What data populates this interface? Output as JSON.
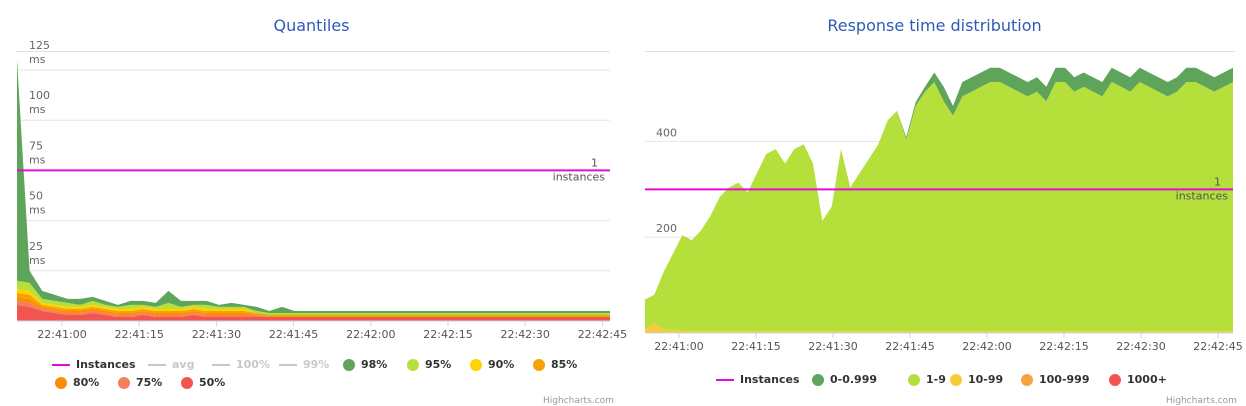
{
  "panels": {
    "left": {
      "title": "Quantiles",
      "credit": "Highcharts.com"
    },
    "right": {
      "title": "Response time distribution",
      "credit": "Highcharts.com"
    }
  },
  "chart_data": [
    {
      "type": "area",
      "title": "Quantiles",
      "x_ticks": [
        "22:41:00",
        "22:41:15",
        "22:41:30",
        "22:41:45",
        "22:42:00",
        "22:42:15",
        "22:42:30",
        "22:42:45"
      ],
      "y_ticks": [
        {
          "value": 25,
          "label": "25",
          "unit": "ms"
        },
        {
          "value": 50,
          "label": "50",
          "unit": "ms"
        },
        {
          "value": 75,
          "label": "75",
          "unit": "ms"
        },
        {
          "value": 100,
          "label": "100",
          "unit": "ms"
        },
        {
          "value": 125,
          "label": "125",
          "unit": "ms"
        }
      ],
      "ylim": [
        0,
        130
      ],
      "instances_line": {
        "value": 75,
        "label_top": "1",
        "label_bottom": "instances",
        "color": "#e30cd8"
      },
      "stacked_series": [
        {
          "name": "50%",
          "color": "#f2554f",
          "values": [
            8,
            7,
            5,
            4,
            3,
            3,
            4,
            3,
            2,
            2,
            3,
            2,
            2,
            2,
            3,
            2,
            2,
            2,
            2,
            2,
            2,
            2,
            2,
            2,
            2,
            2,
            2,
            2,
            2,
            2,
            2,
            2,
            2,
            2,
            2,
            2,
            2,
            2,
            2,
            2,
            2,
            2,
            2,
            2,
            2,
            2,
            2,
            2
          ]
        },
        {
          "name": "75%",
          "color": "#f3805a",
          "values": [
            2,
            2,
            1,
            1,
            1,
            1,
            1,
            1,
            1,
            1,
            1,
            1,
            1,
            1,
            1,
            1,
            1,
            1,
            1,
            1,
            0,
            0,
            0,
            0,
            0,
            0,
            0,
            0,
            0,
            0,
            0,
            0,
            0,
            0,
            0,
            0,
            0,
            0,
            0,
            0,
            0,
            0,
            0,
            0,
            0,
            0,
            0,
            0
          ]
        },
        {
          "name": "80%",
          "color": "#ff8c00",
          "values": [
            2,
            2,
            1,
            1,
            1,
            1,
            1,
            1,
            1,
            1,
            1,
            1,
            1,
            1,
            1,
            1,
            1,
            1,
            1,
            0,
            0,
            0,
            0,
            0,
            0,
            0,
            0,
            0,
            0,
            0,
            0,
            0,
            0,
            0,
            0,
            0,
            0,
            0,
            0,
            0,
            0,
            0,
            0,
            0,
            0,
            0,
            0,
            0
          ]
        },
        {
          "name": "85%",
          "color": "#f5a300",
          "values": [
            2,
            2,
            1,
            1,
            1,
            1,
            1,
            1,
            1,
            1,
            1,
            1,
            1,
            1,
            1,
            1,
            1,
            1,
            1,
            1,
            1,
            1,
            1,
            1,
            1,
            1,
            1,
            1,
            1,
            1,
            1,
            1,
            1,
            1,
            1,
            1,
            1,
            1,
            1,
            1,
            1,
            1,
            1,
            1,
            1,
            1,
            1,
            1
          ]
        },
        {
          "name": "90%",
          "color": "#ffd200",
          "values": [
            2,
            2,
            1,
            1,
            1,
            1,
            1,
            1,
            1,
            1,
            1,
            1,
            1,
            1,
            1,
            1,
            1,
            1,
            1,
            0,
            0,
            0,
            0,
            0,
            0,
            0,
            0,
            0,
            0,
            0,
            0,
            0,
            0,
            0,
            0,
            0,
            0,
            0,
            0,
            0,
            0,
            0,
            0,
            0,
            0,
            0,
            0,
            0
          ]
        },
        {
          "name": "95%",
          "color": "#b5e03b",
          "values": [
            4,
            4,
            2,
            2,
            2,
            1,
            2,
            1,
            1,
            2,
            1,
            1,
            3,
            1,
            1,
            2,
            1,
            1,
            1,
            1,
            1,
            1,
            1,
            1,
            1,
            1,
            1,
            1,
            1,
            1,
            1,
            1,
            1,
            1,
            1,
            1,
            1,
            1,
            1,
            1,
            1,
            1,
            1,
            1,
            1,
            1,
            1,
            1
          ]
        },
        {
          "name": "98%",
          "color": "#5ea45a",
          "values": [
            110,
            6,
            4,
            3,
            2,
            3,
            2,
            2,
            1,
            2,
            2,
            2,
            6,
            3,
            2,
            2,
            1,
            2,
            1,
            2,
            1,
            3,
            1,
            1,
            1,
            1,
            1,
            1,
            1,
            1,
            1,
            1,
            1,
            1,
            1,
            1,
            1,
            1,
            1,
            1,
            1,
            1,
            1,
            1,
            1,
            1,
            1,
            1
          ]
        }
      ]
    },
    {
      "type": "area",
      "title": "Response time distribution",
      "x_ticks": [
        "22:41:00",
        "22:41:15",
        "22:41:30",
        "22:41:45",
        "22:42:00",
        "22:42:15",
        "22:42:30",
        "22:42:45"
      ],
      "y_ticks": [
        {
          "value": 200,
          "label": "200"
        },
        {
          "value": 400,
          "label": "400"
        }
      ],
      "ylim": [
        0,
        570
      ],
      "instances_line": {
        "value": 300,
        "label_top": "1",
        "label_bottom": "instances",
        "color": "#e30cd8"
      },
      "stacked_series": [
        {
          "name": "10-99",
          "color": "#f5cd3c",
          "values": [
            10,
            20,
            8,
            6,
            4,
            4,
            4,
            4,
            4,
            4,
            4,
            4,
            4,
            4,
            4,
            4,
            4,
            4,
            4,
            4,
            4,
            4,
            4,
            4,
            4,
            4,
            4,
            4,
            4,
            4,
            4,
            4,
            4,
            4,
            4,
            4,
            4,
            4,
            4,
            4,
            4,
            4,
            4,
            4,
            4,
            4,
            4,
            4,
            4,
            4,
            4,
            4,
            4,
            4,
            4,
            4,
            4,
            4,
            4,
            4,
            4,
            4,
            4,
            4
          ]
        },
        {
          "name": "1-9",
          "color": "#b5e03b",
          "values": [
            60,
            60,
            120,
            160,
            200,
            190,
            210,
            240,
            280,
            300,
            310,
            290,
            330,
            370,
            380,
            350,
            380,
            390,
            350,
            230,
            260,
            380,
            300,
            330,
            360,
            390,
            440,
            460,
            400,
            470,
            500,
            520,
            480,
            450,
            490,
            500,
            510,
            520,
            520,
            510,
            500,
            490,
            500,
            480,
            520,
            520,
            500,
            510,
            500,
            490,
            520,
            510,
            500,
            520,
            510,
            500,
            490,
            500,
            520,
            520,
            510,
            500,
            510,
            520
          ]
        },
        {
          "name": "0-0.999",
          "color": "#5ea45a",
          "values": [
            0,
            0,
            0,
            0,
            0,
            0,
            0,
            0,
            0,
            0,
            0,
            0,
            0,
            0,
            0,
            0,
            0,
            0,
            0,
            0,
            0,
            0,
            0,
            0,
            0,
            0,
            0,
            0,
            5,
            8,
            10,
            20,
            30,
            20,
            30,
            30,
            30,
            30,
            30,
            30,
            30,
            30,
            30,
            30,
            30,
            30,
            30,
            30,
            30,
            30,
            30,
            30,
            30,
            30,
            30,
            30,
            30,
            30,
            30,
            30,
            30,
            30,
            30,
            30
          ]
        }
      ]
    }
  ],
  "legends": {
    "left": [
      {
        "label": "Instances",
        "kind": "line",
        "color": "#e30cd8",
        "active": true
      },
      {
        "label": "avg",
        "kind": "line",
        "color": "#c8c8c8",
        "active": false
      },
      {
        "label": "100%",
        "kind": "line",
        "color": "#c8c8c8",
        "active": false
      },
      {
        "label": "99%",
        "kind": "line",
        "color": "#c8c8c8",
        "active": false
      },
      {
        "label": "98%",
        "kind": "dot",
        "color": "#5ea45a",
        "active": true
      },
      {
        "label": "95%",
        "kind": "dot",
        "color": "#b5e03b",
        "active": true
      },
      {
        "label": "90%",
        "kind": "dot",
        "color": "#ffd200",
        "active": true
      },
      {
        "label": "85%",
        "kind": "dot",
        "color": "#f5a300",
        "active": true
      },
      {
        "label": "80%",
        "kind": "dot",
        "color": "#ff8c00",
        "active": true
      },
      {
        "label": "75%",
        "kind": "dot",
        "color": "#f3805a",
        "active": true
      },
      {
        "label": "50%",
        "kind": "dot",
        "color": "#f2554f",
        "active": true
      }
    ],
    "right": [
      {
        "label": "Instances",
        "kind": "line",
        "color": "#e30cd8",
        "active": true
      },
      {
        "label": "0-0.999",
        "kind": "dot",
        "color": "#5ea45a",
        "active": true
      },
      {
        "label": "1-9",
        "kind": "dot",
        "color": "#b5e03b",
        "active": true
      },
      {
        "label": "10-99",
        "kind": "dot",
        "color": "#f5cd3c",
        "active": true
      },
      {
        "label": "100-999",
        "kind": "dot",
        "color": "#f5a33c",
        "active": true
      },
      {
        "label": "1000+",
        "kind": "dot",
        "color": "#f2554f",
        "active": true
      }
    ]
  }
}
